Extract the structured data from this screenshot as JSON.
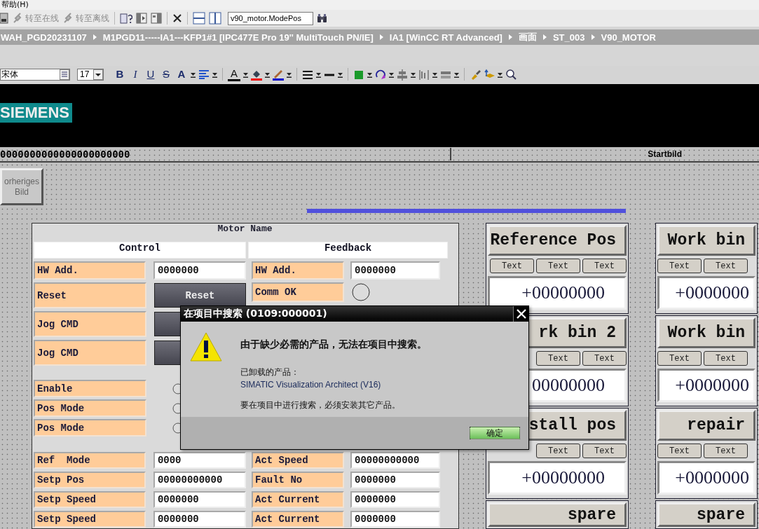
{
  "menu_bar": {
    "items": [
      "帮助(H)"
    ]
  },
  "toolbar": {
    "actions": [
      {
        "label": "转至在线",
        "disabled": true
      },
      {
        "label": "转至离线",
        "disabled": true
      }
    ],
    "tag_field": {
      "value": "v90_motor.ModePos"
    }
  },
  "breadcrumb": [
    "WAH_PGD20231107",
    "M1PGD11-----IA1---KFP1#1 [IPC477E Pro 19'' MultiTouch PN/IE]",
    "IA1 [WinCC RT Advanced]",
    "画面",
    "ST_003",
    "V90_MOTOR"
  ],
  "format_bar": {
    "font_field": {
      "value": "宋体"
    },
    "size_field": {
      "value": "17"
    },
    "style_buttons": [
      {
        "kind": "bold",
        "label": "B"
      },
      {
        "kind": "italic",
        "label": "I"
      },
      {
        "kind": "underline",
        "label": "U"
      },
      {
        "kind": "strike",
        "label": "S"
      },
      {
        "kind": "grow",
        "label": "A"
      },
      {
        "kind": "color",
        "label": "A"
      }
    ]
  },
  "screen": {
    "logo": "SIEMENS",
    "status_value": "0000000000000000000000",
    "screen_name": "Startbild",
    "nav_button": "orheriges Bild"
  },
  "motor_panel": {
    "title": "Motor Name",
    "control": {
      "header": "Control",
      "top_rows": [
        {
          "kind": "field",
          "label": "HW Add.",
          "value": "0000000"
        },
        {
          "kind": "button",
          "label": "Reset",
          "button": "Reset"
        },
        {
          "kind": "button",
          "label": "Jog CMD"
        },
        {
          "kind": "button",
          "label": "Jog CMD"
        }
      ],
      "middle_rows": [
        {
          "kind": "radio",
          "label": "Enable",
          "checked": false
        },
        {
          "kind": "radio",
          "label": "Pos Mode",
          "checked": false
        },
        {
          "kind": "radio",
          "label": "Pos Mode",
          "checked": false
        }
      ],
      "bottom_rows": [
        {
          "kind": "field",
          "label": "Ref  Mode",
          "value": "0000"
        },
        {
          "kind": "field",
          "label": "Setp Pos",
          "value": "00000000000"
        },
        {
          "kind": "field",
          "label": "Setp Speed",
          "value": "0000000"
        },
        {
          "kind": "field",
          "label": "Setp Speed",
          "value": "0000000"
        }
      ]
    },
    "feedback": {
      "header": "Feedback",
      "top_rows": [
        {
          "kind": "field",
          "label": "HW Add.",
          "value": "0000000"
        },
        {
          "kind": "lamp",
          "label": "Comm OK"
        }
      ],
      "bottom_rows": [
        {
          "kind": "field",
          "label": "Act Speed",
          "value": "00000000000"
        },
        {
          "kind": "field",
          "label": "Fault No",
          "value": "0000000"
        },
        {
          "kind": "field",
          "label": "Act Current",
          "value": "0000000"
        },
        {
          "kind": "field",
          "label": "Act Current",
          "value": "0000000"
        }
      ]
    }
  },
  "tiles": {
    "column_1": [
      {
        "title": "Reference Pos",
        "buttons": [
          "Text",
          "Text",
          "Text"
        ],
        "value": "+00000000"
      },
      {
        "title": "rk bin 2",
        "buttons": [
          "Text",
          "Text"
        ],
        "value": "00000000"
      },
      {
        "title": "stall pos",
        "buttons": [
          "Text",
          "Text"
        ],
        "value": "+00000000"
      },
      {
        "title": "spare"
      }
    ],
    "column_2": [
      {
        "title": "Work bin",
        "buttons": [
          "Text",
          "Text"
        ],
        "value": "+0000000"
      },
      {
        "title": "Work bin",
        "buttons": [
          "Text",
          "Text"
        ],
        "value": "+0000000"
      },
      {
        "title": "repair",
        "buttons": [
          "Text",
          "Text"
        ],
        "value": "+0000000"
      },
      {
        "title": "spare"
      }
    ]
  },
  "dialog": {
    "title": "在项目中搜索 (0109:000001)",
    "message": "由于缺少必需的产品，无法在项目中搜索。",
    "detail_label": "已卸载的产品：",
    "product": "SIMATIC Visualization Architect (V16)",
    "hint": "要在项目中进行搜索，必须安装其它产品。",
    "ok_button": "确定"
  }
}
